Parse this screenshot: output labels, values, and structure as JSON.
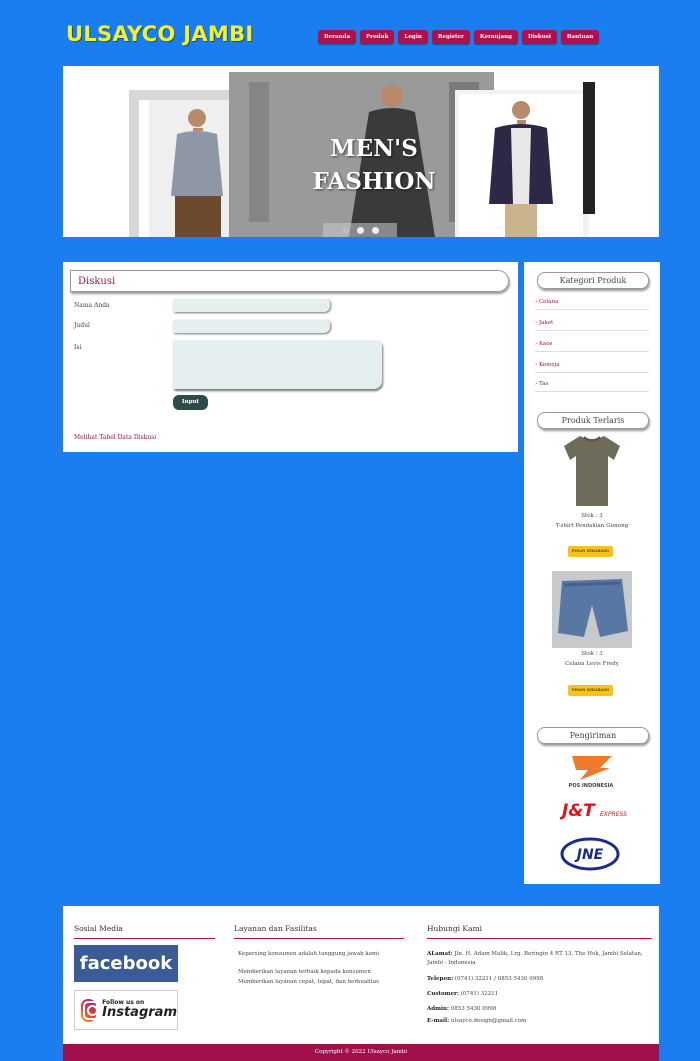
{
  "brand": {
    "name": "ULSAYCO JAMBI"
  },
  "nav": [
    {
      "label": "Beranda"
    },
    {
      "label": "Produk"
    },
    {
      "label": "Login"
    },
    {
      "label": "Register"
    },
    {
      "label": "Keranjang"
    },
    {
      "label": "Diskusi"
    },
    {
      "label": "Bantuan"
    }
  ],
  "banner": {
    "line1": "MEN'S",
    "line2": "FASHION",
    "slide_count": 3,
    "active_slide": 1
  },
  "form": {
    "heading": "Diskusi",
    "name_label": "Nama Anda",
    "title_label": "Judul",
    "body_label": "Isi",
    "name_value": "",
    "title_value": "",
    "body_value": "",
    "submit_label": "Input",
    "table_link": "Melihat Tabel Data Diskusi"
  },
  "sidebar": {
    "category_heading": "Kategori Produk",
    "categories": [
      {
        "label": "Celana"
      },
      {
        "label": "Jaket"
      },
      {
        "label": "Kaos"
      },
      {
        "label": "Kemeja"
      },
      {
        "label": "Tas"
      }
    ],
    "bestseller_heading": "Produk Terlaris",
    "products": [
      {
        "stock": "Stok : 3",
        "name": "T-shirt Pendakian Gunung",
        "buy_label": "PESAN SEKARANG"
      },
      {
        "stock": "Stok : 3",
        "name": "Celana Levis Fredy",
        "buy_label": "PESAN SEKARANG"
      }
    ],
    "shipping_heading": "Pengiriman",
    "couriers": [
      {
        "name": "POS INDONESIA"
      },
      {
        "name": "J&T EXPRESS"
      },
      {
        "name": "JNE"
      }
    ]
  },
  "footer": {
    "social_heading": "Sosial Media",
    "facebook_label": "facebook",
    "instagram_small": "Follow us on",
    "instagram_big": "Instagram",
    "services_heading": "Layanan dan Fasilitas",
    "services": [
      "Kepersing konsumen adalah tanggung jawab kami",
      "Memberikan layanan terbaik kepada konsumen",
      "Memberikan layanan cepat, tepat, dan berkualitas"
    ],
    "contact_heading": "Hubungi Kami",
    "contact": {
      "address_label": "ALamat:",
      "address": "Jln. H. Adam Malik, Lrg. Beringin 4 RT 13, The Hok, Jambi Selatan, Jambi - Indonesia",
      "phone_label": "Telepon:",
      "phone": "(0741) 32211 / 0853 5430 0998",
      "customer_label": "Customer:",
      "customer": "(0741) 32211",
      "admin_label": "Admin:",
      "admin": "0853 5430 0998",
      "email_label": "E-mail:",
      "email": "ulsayco.design@gmail.com"
    },
    "copyright": "Copyright © 2022 Ulsayco Jambi"
  },
  "colors": {
    "page_bg": "#1a7ef0",
    "accent": "#b0104e",
    "logo": "#f5f02a",
    "button_dark": "#2c4c4a",
    "buy_button": "#f6c21b"
  }
}
